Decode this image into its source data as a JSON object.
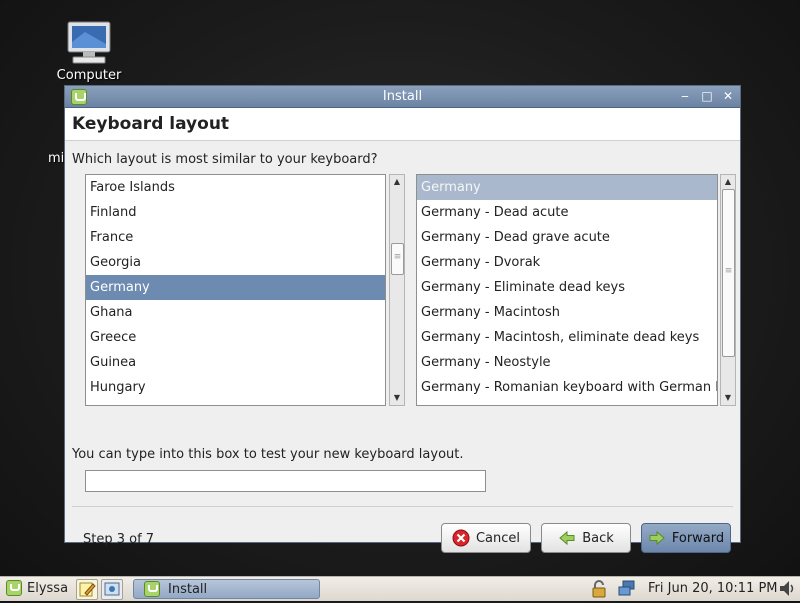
{
  "desktop": {
    "icons": [
      {
        "label": "Computer",
        "icon": "computer-icon"
      }
    ],
    "partial_label": "mi"
  },
  "window": {
    "title": "Install",
    "heading": "Keyboard layout",
    "question": "Which layout is most similar to your keyboard?",
    "countries": [
      "Faroe Islands",
      "Finland",
      "France",
      "Georgia",
      "Germany",
      "Ghana",
      "Greece",
      "Guinea",
      "Hungary"
    ],
    "selected_country": "Germany",
    "variants": [
      "Germany",
      "Germany - Dead acute",
      "Germany - Dead grave acute",
      "Germany - Dvorak",
      "Germany - Eliminate dead keys",
      "Germany - Macintosh",
      "Germany - Macintosh, eliminate dead keys",
      "Germany - Neostyle",
      "Germany - Romanian keyboard with German letters"
    ],
    "selected_variant": "Germany",
    "test_hint": "You can type into this box to test your new keyboard layout.",
    "test_input_value": "",
    "step": "Step 3 of 7",
    "buttons": {
      "cancel": "Cancel",
      "back": "Back",
      "forward": "Forward"
    }
  },
  "taskbar": {
    "menu_label": "Elyssa",
    "task_label": "Install",
    "clock": "Fri Jun 20, 10:11 PM"
  },
  "colors": {
    "selection": "#6d8ab0",
    "titlebar": "#7a90b0",
    "panel": "#e6e2da"
  }
}
